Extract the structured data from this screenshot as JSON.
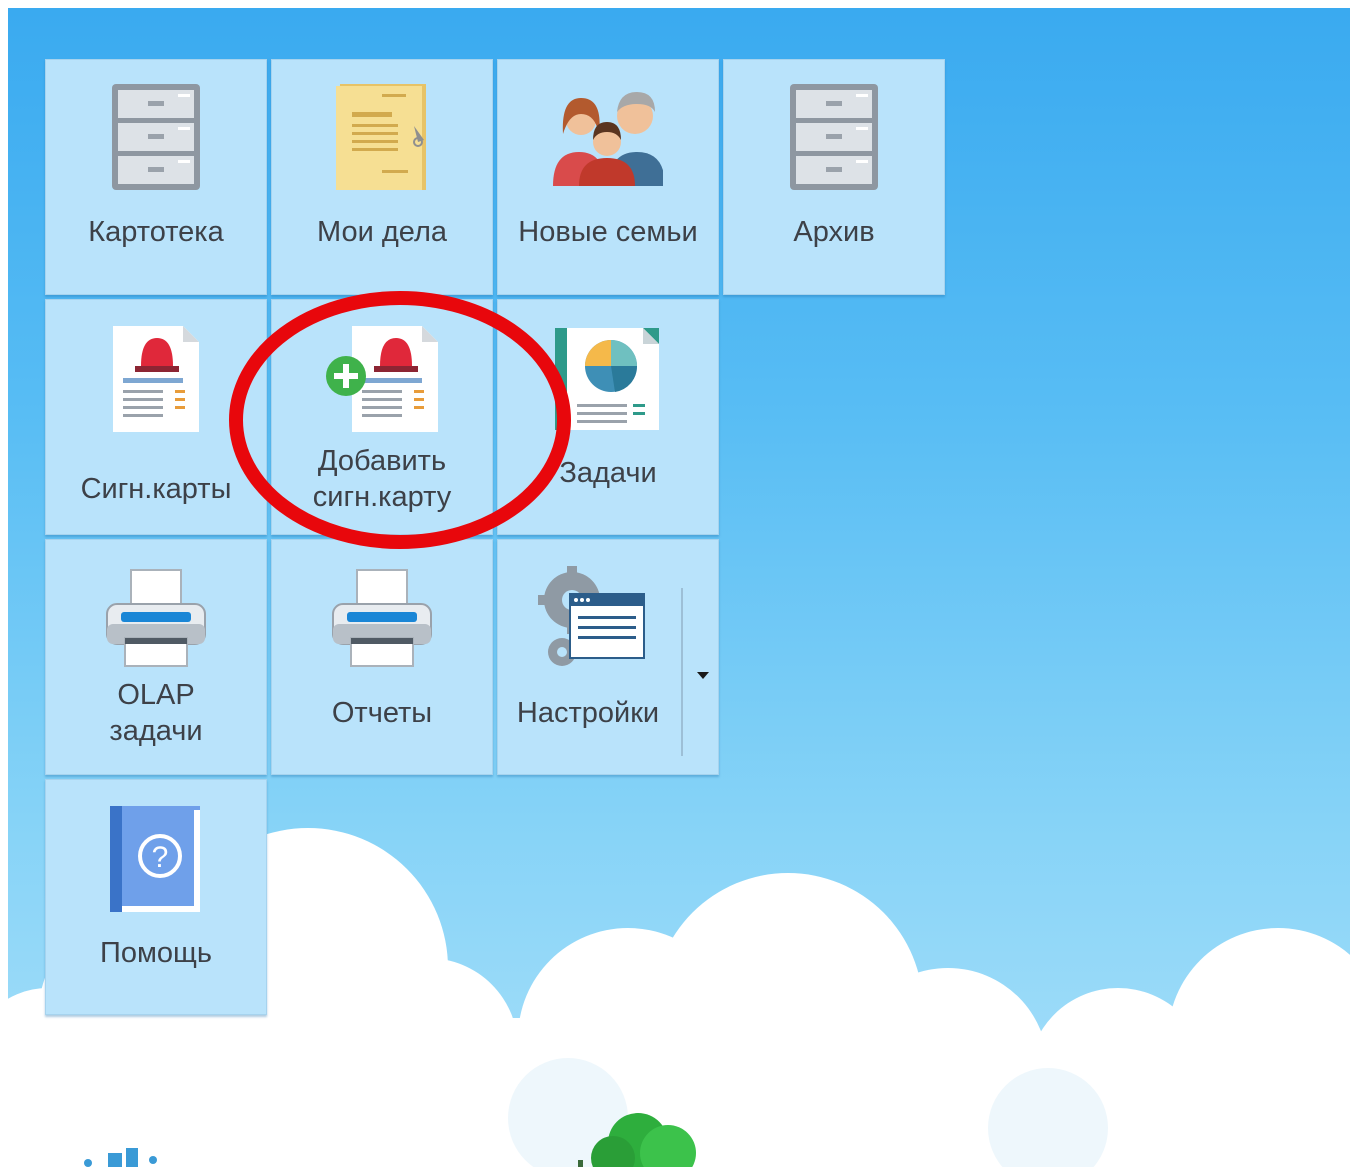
{
  "tiles": [
    {
      "id": "kartoteka",
      "label": "Картотека",
      "icon": "filing-cabinet-icon"
    },
    {
      "id": "moi-dela",
      "label": "Мои дела",
      "icon": "folder-document-icon"
    },
    {
      "id": "novye-semi",
      "label": "Новые семьи",
      "icon": "family-icon"
    },
    {
      "id": "arkhiv",
      "label": "Архив",
      "icon": "filing-cabinet-icon"
    },
    {
      "id": "sign-karty",
      "label": "Сигн.карты",
      "icon": "alarm-card-icon"
    },
    {
      "id": "dobavit-sign-kartu",
      "label_line1": "Добавить",
      "label_line2": "сигн.карту",
      "icon": "add-alarm-card-icon"
    },
    {
      "id": "zadachi",
      "label": "Задачи",
      "icon": "pie-chart-report-icon"
    },
    {
      "id": "olap-zadachi",
      "label_line1": "OLAP",
      "label_line2": "задачи",
      "icon": "printer-icon"
    },
    {
      "id": "otchety",
      "label": "Отчеты",
      "icon": "printer-icon"
    },
    {
      "id": "nastroyki",
      "label": "Настройки",
      "icon": "settings-gears-window-icon",
      "dropdown_icon": "caret-down-icon"
    },
    {
      "id": "pomosch",
      "label": "Помощь",
      "icon": "help-book-icon"
    }
  ],
  "annotation": {
    "shape": "circle",
    "color": "#e8070c"
  },
  "colors": {
    "tile_bg": "#b9e3fb",
    "sky_top": "#3aaaf0",
    "sky_bottom": "#a9e0fa",
    "label": "#3d4148"
  }
}
